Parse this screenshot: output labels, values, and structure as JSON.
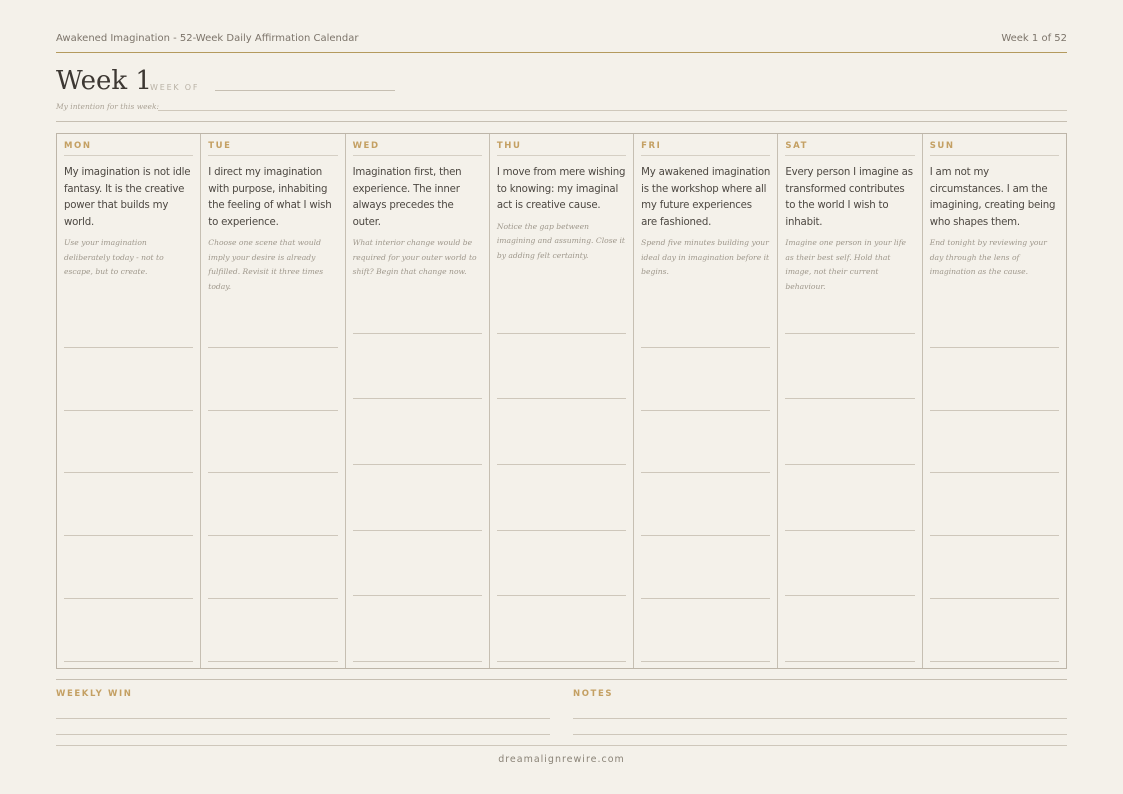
{
  "header": {
    "title": "Awakened Imagination - 52-Week Daily Affirmation Calendar",
    "progress": "Week 1 of 52"
  },
  "week": {
    "title": "Week 1",
    "week_of_label": "WEEK OF",
    "intention_label": "My intention for this week:"
  },
  "days": [
    {
      "name": "MON",
      "affirmation": "My imagination is not idle fantasy. It is the creative power that builds my world.",
      "prompt": "Use your imagination deliberately today - not to escape, but to create."
    },
    {
      "name": "TUE",
      "affirmation": "I direct my imagination with purpose, inhabiting the feeling of what I wish to experience.",
      "prompt": "Choose one scene that would imply your desire is already fulfilled. Revisit it three times today."
    },
    {
      "name": "WED",
      "affirmation": "Imagination first, then experience. The inner always precedes the outer.",
      "prompt": "What interior change would be required for your outer world to shift? Begin that change now."
    },
    {
      "name": "THU",
      "affirmation": "I move from mere wishing to knowing: my imaginal act is creative cause.",
      "prompt": "Notice the gap between imagining and assuming. Close it by adding felt certainty."
    },
    {
      "name": "FRI",
      "affirmation": "My awakened imagination is the workshop where all my future experiences are fashioned.",
      "prompt": "Spend five minutes building your ideal day in imagination before it begins."
    },
    {
      "name": "SAT",
      "affirmation": "Every person I imagine as transformed contributes to the world I wish to inhabit.",
      "prompt": "Imagine one person in your life as their best self. Hold that image, not their current behaviour."
    },
    {
      "name": "SUN",
      "affirmation": "I am not my circumstances. I am the imagining, creating being who shapes them.",
      "prompt": "End tonight by reviewing your day through the lens of imagination as the cause."
    }
  ],
  "bottom": {
    "weekly_win_label": "WEEKLY WIN",
    "notes_label": "NOTES"
  },
  "footer": {
    "site": "dreamalignrewire.com"
  }
}
